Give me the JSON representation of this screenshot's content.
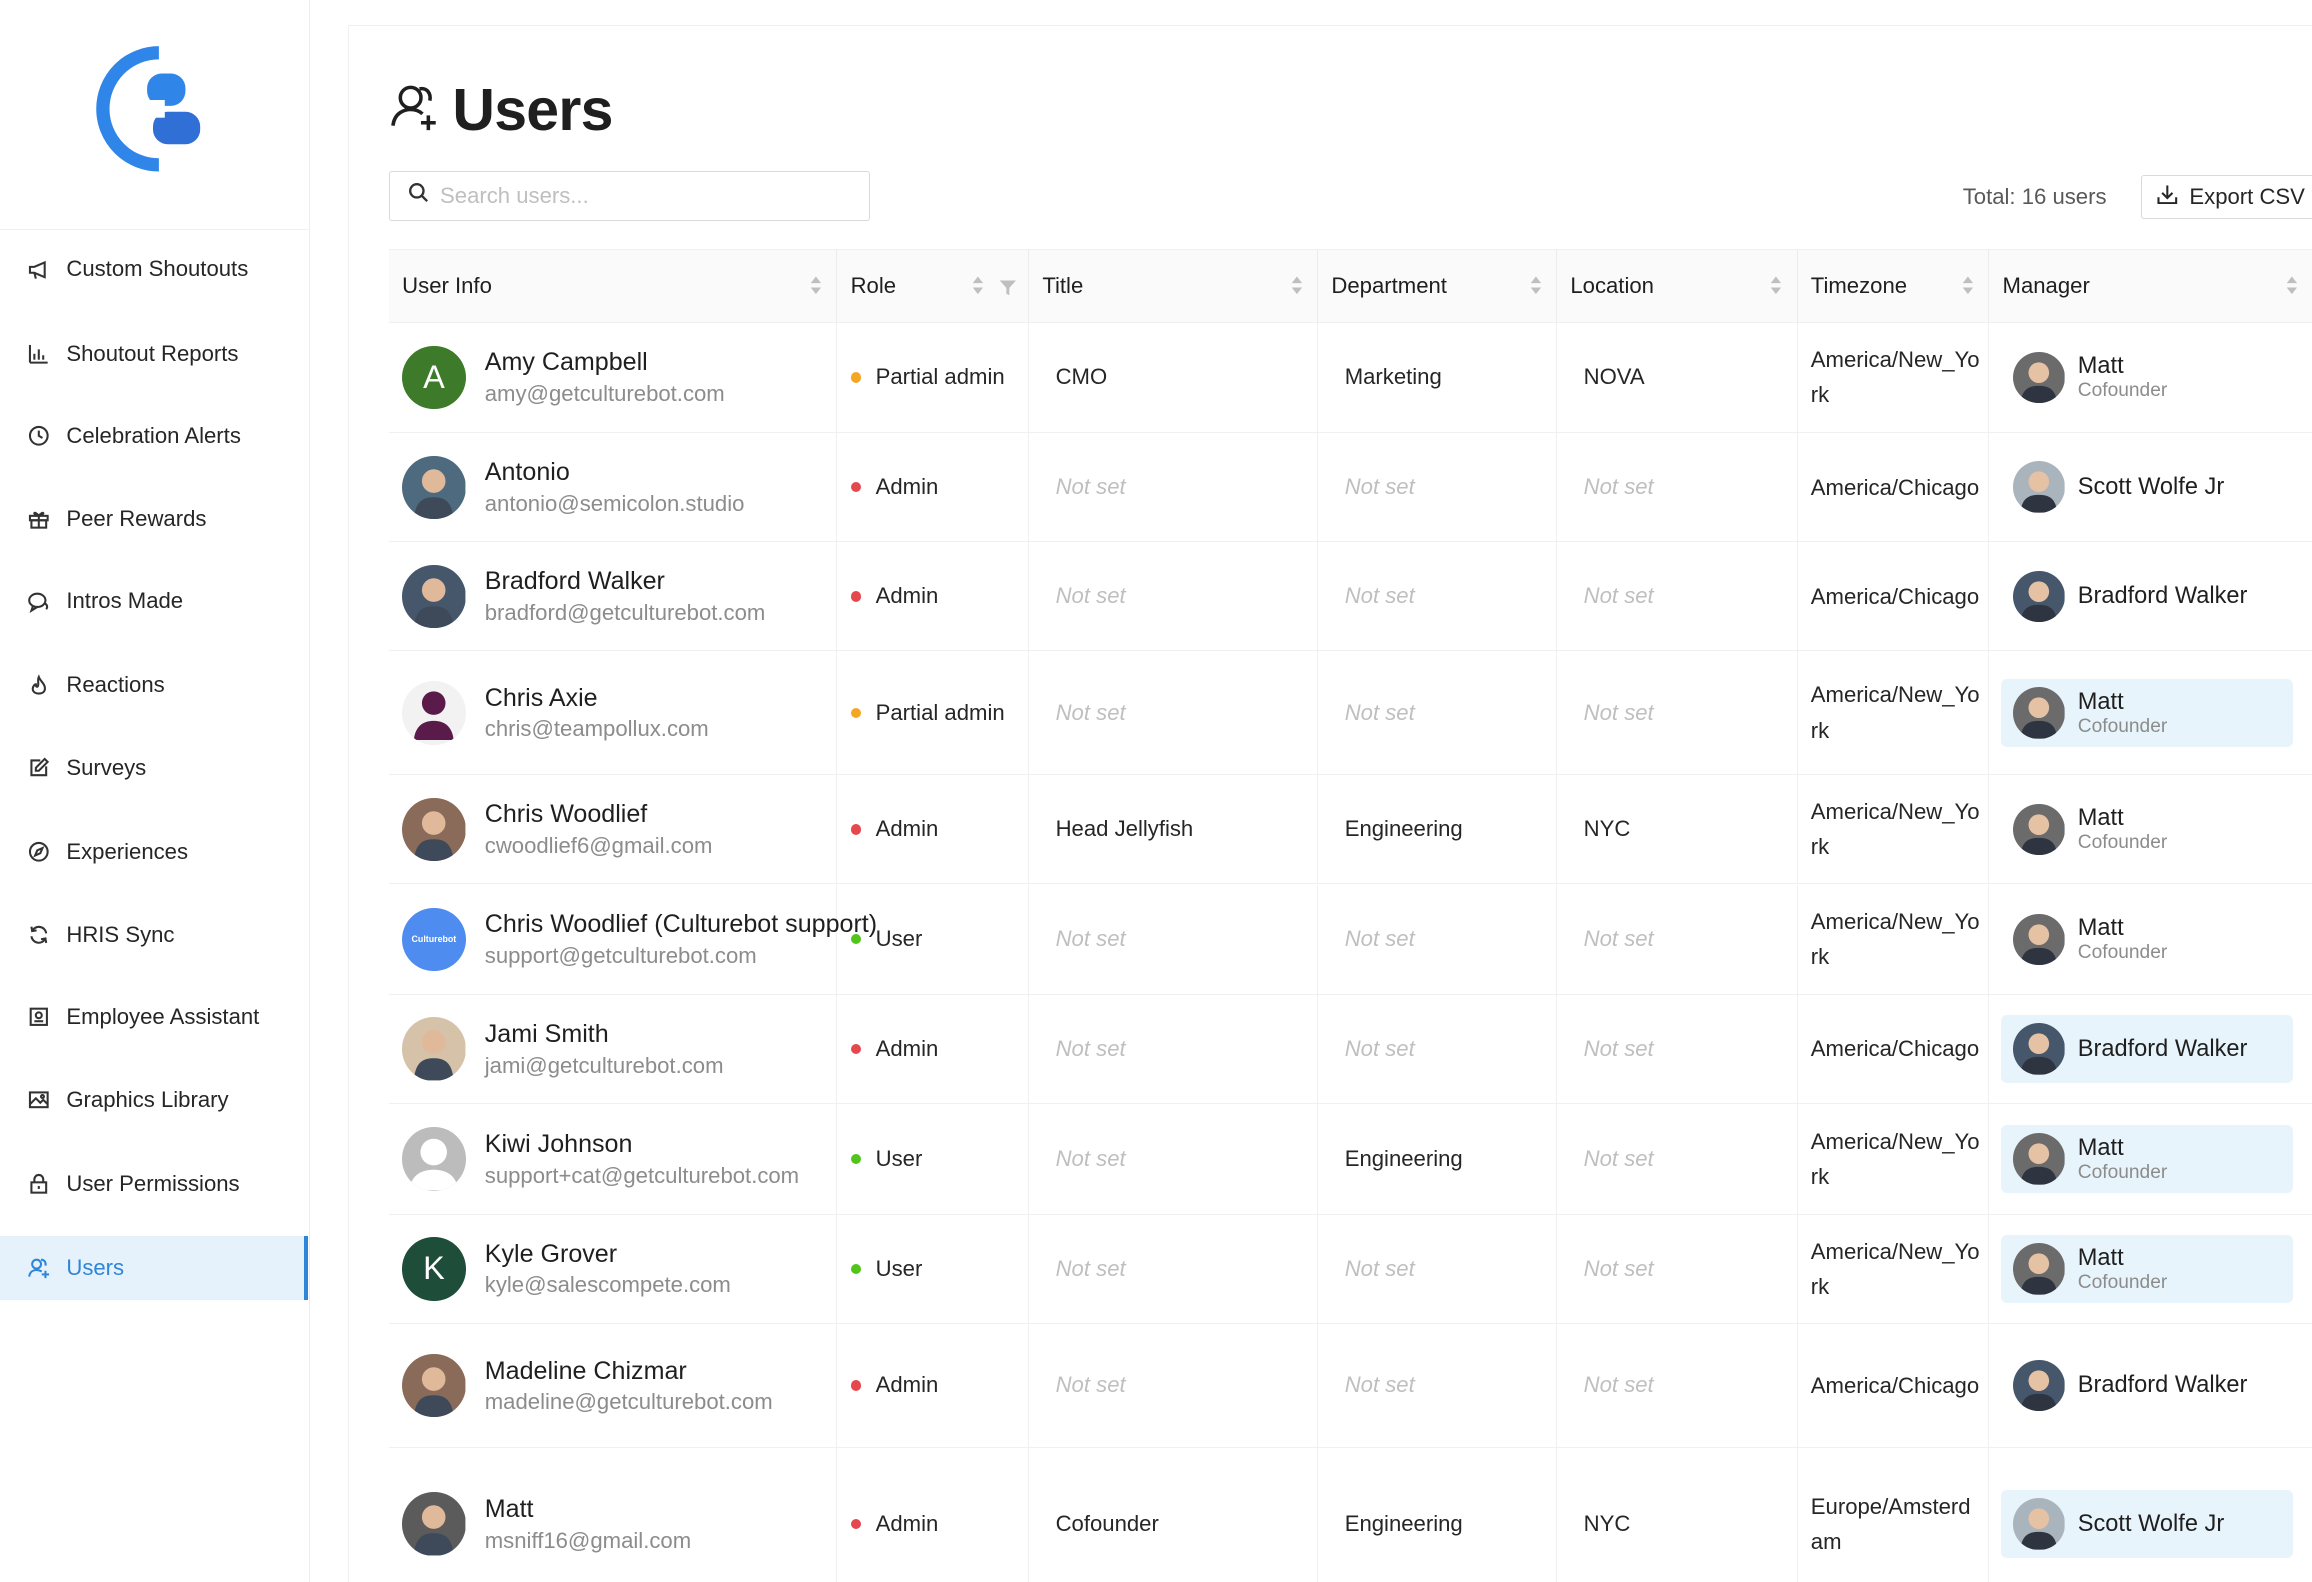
{
  "sidebar": {
    "items": [
      {
        "label": "Custom Shoutouts",
        "icon": "megaphone-icon"
      },
      {
        "label": "Shoutout Reports",
        "icon": "bar-chart-icon"
      },
      {
        "label": "Celebration Alerts",
        "icon": "clock-icon"
      },
      {
        "label": "Peer Rewards",
        "icon": "gift-icon"
      },
      {
        "label": "Intros Made",
        "icon": "chat-bubbles-icon"
      },
      {
        "label": "Reactions",
        "icon": "fire-icon"
      },
      {
        "label": "Surveys",
        "icon": "edit-icon"
      },
      {
        "label": "Experiences",
        "icon": "compass-icon"
      },
      {
        "label": "HRIS Sync",
        "icon": "sync-icon"
      },
      {
        "label": "Employee Assistant",
        "icon": "assistant-icon"
      },
      {
        "label": "Graphics Library",
        "icon": "picture-icon"
      },
      {
        "label": "User Permissions",
        "icon": "lock-icon"
      },
      {
        "label": "Users",
        "icon": "users-icon",
        "active": true
      }
    ],
    "accent": "#2f86d9"
  },
  "page": {
    "title": "Users",
    "search_placeholder": "Search users...",
    "total": "Total: 16 users",
    "export_label": "Export CSV"
  },
  "table": {
    "columns": [
      "User Info",
      "Role",
      "Title",
      "Department",
      "Location",
      "Timezone",
      "Manager"
    ],
    "rows": [
      {
        "name": "Amy Campbell",
        "email": "amy@getculturebot.com",
        "avatar": "A",
        "avatar_color": "#3d7a2a",
        "role": "Partial admin",
        "role_color": "#f5a623",
        "title": "CMO",
        "department": "Marketing",
        "location": "NOVA",
        "timezone": "America/New_York",
        "manager": "Matt",
        "manager_title": "Cofounder",
        "manager_highlight": false
      },
      {
        "name": "Antonio",
        "email": "antonio@semicolon.studio",
        "avatar": "",
        "avatar_color": "#4e6a7e",
        "role": "Admin",
        "role_color": "#e5484d",
        "title": "Not set",
        "department": "Not set",
        "location": "Not set",
        "timezone": "America/Chicago",
        "manager": "Scott Wolfe Jr",
        "manager_title": "",
        "manager_highlight": false
      },
      {
        "name": "Bradford Walker",
        "email": "bradford@getculturebot.com",
        "avatar": "",
        "avatar_color": "#46566b",
        "role": "Admin",
        "role_color": "#e5484d",
        "title": "Not set",
        "department": "Not set",
        "location": "Not set",
        "timezone": "America/Chicago",
        "manager": "Bradford Walker",
        "manager_title": "",
        "manager_highlight": false
      },
      {
        "name": "Chris Axie",
        "email": "chris@teampollux.com",
        "avatar": "",
        "avatar_color": "#ffffff",
        "role": "Partial admin",
        "role_color": "#f5a623",
        "title": "Not set",
        "department": "Not set",
        "location": "Not set",
        "timezone": "America/New_York",
        "manager": "Matt",
        "manager_title": "Cofounder",
        "manager_highlight": true
      },
      {
        "name": "Chris Woodlief",
        "email": "cwoodlief6@gmail.com",
        "avatar": "",
        "avatar_color": "#8a6a58",
        "role": "Admin",
        "role_color": "#e5484d",
        "title": "Head Jellyfish",
        "department": "Engineering",
        "location": "NYC",
        "timezone": "America/New_York",
        "manager": "Matt",
        "manager_title": "Cofounder",
        "manager_highlight": false
      },
      {
        "name": "Chris Woodlief (Culturebot support)",
        "email": "support@getculturebot.com",
        "avatar": "Culturebot",
        "avatar_color": "#4f8cf0",
        "role": "User",
        "role_color": "#52c41a",
        "title": "Not set",
        "department": "Not set",
        "location": "Not set",
        "timezone": "America/New_York",
        "manager": "Matt",
        "manager_title": "Cofounder",
        "manager_highlight": false
      },
      {
        "name": "Jami Smith",
        "email": "jami@getculturebot.com",
        "avatar": "",
        "avatar_color": "#d6c2a8",
        "role": "Admin",
        "role_color": "#e5484d",
        "title": "Not set",
        "department": "Not set",
        "location": "Not set",
        "timezone": "America/Chicago",
        "manager": "Bradford Walker",
        "manager_title": "",
        "manager_highlight": true
      },
      {
        "name": "Kiwi Johnson",
        "email": "support+cat@getculturebot.com",
        "avatar": "",
        "avatar_color": "#b8b8b8",
        "role": "User",
        "role_color": "#52c41a",
        "title": "Not set",
        "department": "Engineering",
        "location": "Not set",
        "timezone": "America/New_York",
        "manager": "Matt",
        "manager_title": "Cofounder",
        "manager_highlight": true
      },
      {
        "name": "Kyle Grover",
        "email": "kyle@salescompete.com",
        "avatar": "K",
        "avatar_color": "#1e4d3a",
        "role": "User",
        "role_color": "#52c41a",
        "title": "Not set",
        "department": "Not set",
        "location": "Not set",
        "timezone": "America/New_York",
        "manager": "Matt",
        "manager_title": "Cofounder",
        "manager_highlight": true
      },
      {
        "name": "Madeline Chizmar",
        "email": "madeline@getculturebot.com",
        "avatar": "",
        "avatar_color": "#8a6b5a",
        "role": "Admin",
        "role_color": "#e5484d",
        "title": "Not set",
        "department": "Not set",
        "location": "Not set",
        "timezone": "America/Chicago",
        "manager": "Bradford Walker",
        "manager_title": "",
        "manager_highlight": false
      },
      {
        "name": "Matt",
        "email": "msniff16@gmail.com",
        "avatar": "",
        "avatar_color": "#5b5b5b",
        "role": "Admin",
        "role_color": "#e5484d",
        "title": "Cofounder",
        "department": "Engineering",
        "location": "NYC",
        "timezone": "Europe/Amsterdam",
        "manager": "Scott Wolfe Jr",
        "manager_title": "",
        "manager_highlight": true
      }
    ]
  }
}
